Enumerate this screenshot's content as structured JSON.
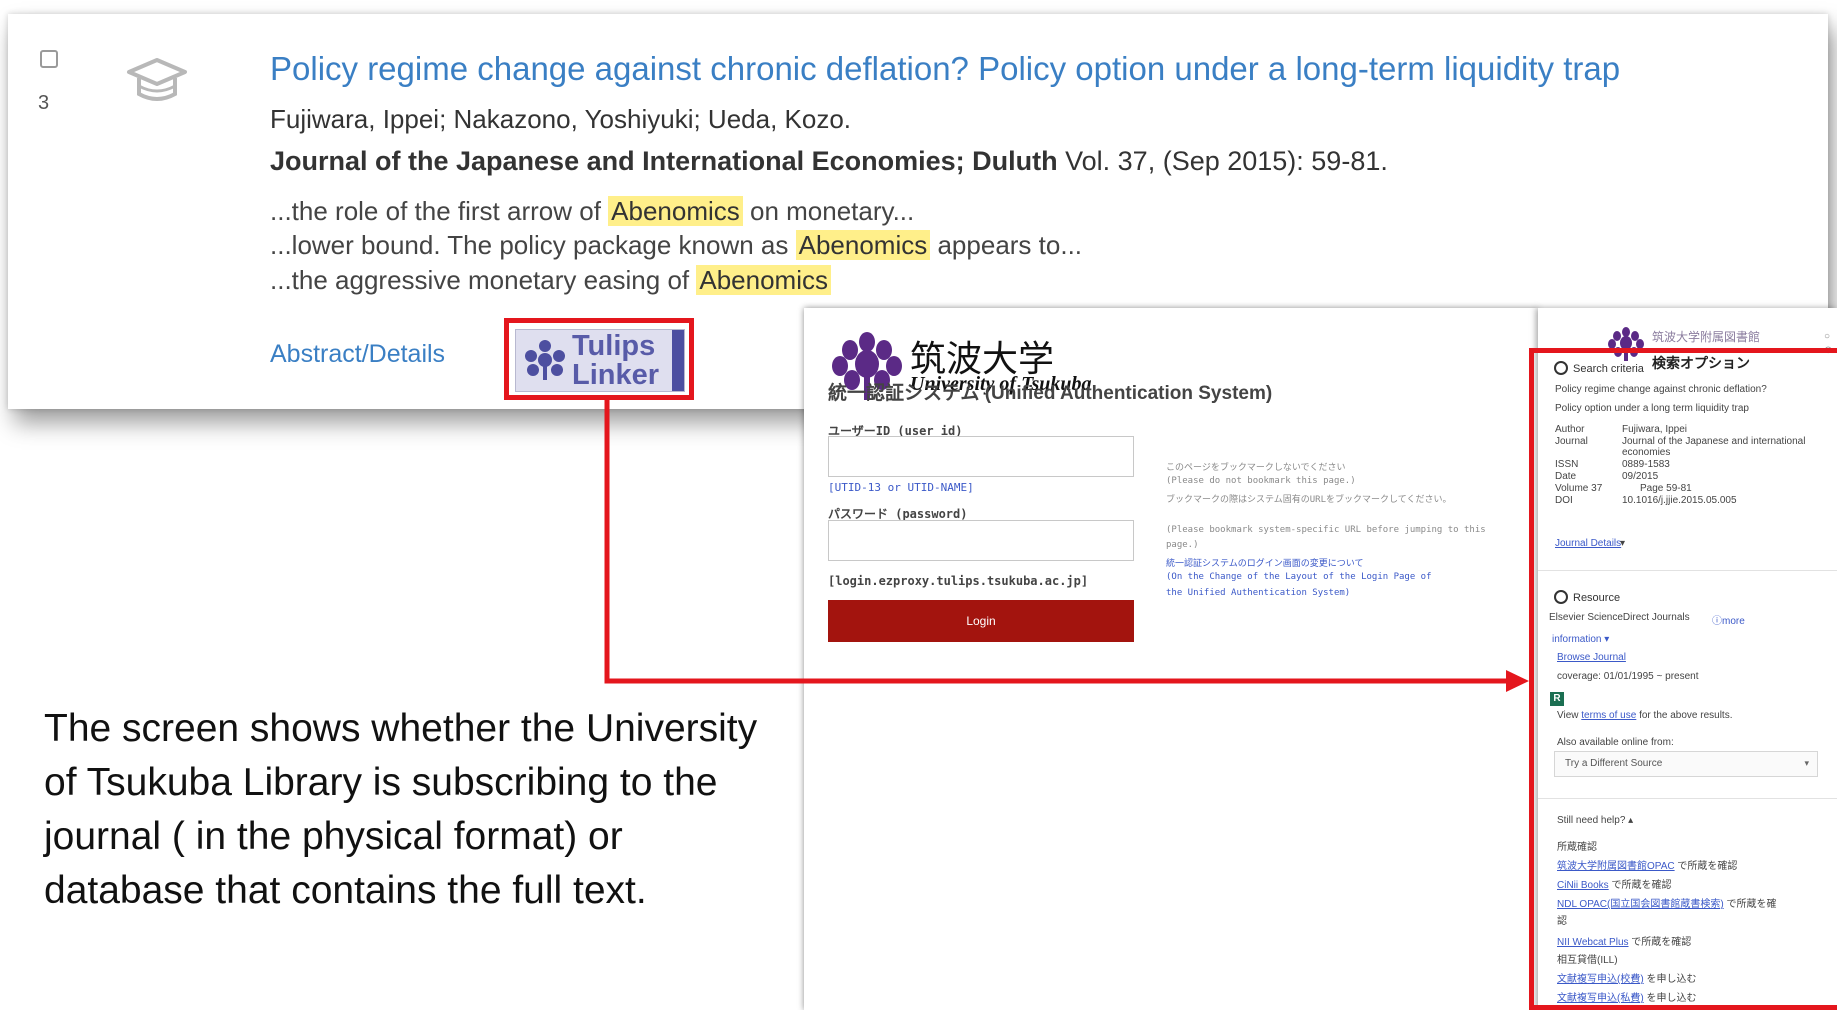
{
  "result": {
    "number": "3",
    "title": "Policy regime change against chronic deflation? Policy option under a long-term liquidity trap",
    "authors": "Fujiwara, Ippei; Nakazono, Yoshiyuki; Ueda, Kozo.",
    "journal": "Journal of the Japanese and International Economies; Duluth",
    "citation": " Vol. 37,  (Sep 2015): 59-81.",
    "snippets": [
      {
        "pre": "...the role of the first arrow of ",
        "hl": "Abenomics",
        "post": " on monetary..."
      },
      {
        "pre": "...lower bound. The policy package known as ",
        "hl": "Abenomics",
        "post": " appears to..."
      },
      {
        "pre": "...the aggressive monetary easing of ",
        "hl": "Abenomics",
        "post": ""
      }
    ],
    "abstract_link": "Abstract/Details",
    "linker_label_1": "Tulips",
    "linker_label_2": "Linker"
  },
  "login": {
    "brand_jp": "筑波大学",
    "brand_en": "University of Tsukuba",
    "title": "統一認証システム (Unified Authentication System)",
    "user_label": "ユーザーID (user id)",
    "utid": "[UTID-13 or UTID-NAME]",
    "password_label": "パスワード (password)",
    "domain": "[login.ezproxy.tulips.tsukuba.ac.jp]",
    "button": "Login",
    "notes": [
      "このページをブックマークしないでください",
      "(Please do not bookmark this page.)",
      "ブックマークの際はシステム固有のURLをブックマークしてください。",
      "(Please bookmark system-specific URL before jumping to this",
      "page.)",
      "統一認証システムのログイン画面の変更について",
      "(On the Change of the Layout of the Login Page of",
      "the Unified Authentication System)"
    ]
  },
  "library": {
    "title": "筑波大学附属図書館",
    "subtitle": "検索オプション",
    "criteria_head": "Search criteria",
    "criteria_title_1": "Policy regime change against chronic deflation?",
    "criteria_title_2": "Policy option under a long term liquidity trap",
    "fields": [
      {
        "k": "Author",
        "v": "Fujiwara, Ippei"
      },
      {
        "k": "Journal",
        "v": "Journal of the Japanese and international"
      },
      {
        "k": "",
        "v": "economies"
      },
      {
        "k": "ISSN",
        "v": "0889-1583"
      },
      {
        "k": "Date",
        "v": "09/2015"
      },
      {
        "k": "Volume 37",
        "v": "Page 59-81"
      },
      {
        "k": "DOI",
        "v": "10.1016/j.jjie.2015.05.005"
      }
    ],
    "journal_details": "Journal Details",
    "resource_head": "Resource",
    "resource_name": "Elsevier ScienceDirect Journals",
    "more_info": "ⓘmore",
    "information": "information",
    "browse": "Browse Journal",
    "coverage": "coverage: 01/01/1995 ~ present",
    "badge": "R",
    "view_pre": "View ",
    "terms": "terms of use",
    "view_post": " for the above results.",
    "also": "Also available online from:",
    "try": "Try a Different Source",
    "help_head": "Still need help?",
    "holdings_head": "所蔵確認",
    "help_links": [
      {
        "link": "筑波大学附属図書館OPAC",
        "text": " で所蔵を確認"
      },
      {
        "link": "CiNii Books",
        "text": " で所蔵を確認"
      },
      {
        "link": "NDL OPAC(国立国会図書館蔵書検索)",
        "text": " で所蔵を確"
      },
      {
        "link": "",
        "text": "認"
      },
      {
        "link": "NII Webcat Plus",
        "text": " で所蔵を確認"
      },
      {
        "link": "",
        "text": "相互貸借(ILL)"
      },
      {
        "link": "文献複写申込(校費)",
        "text": " を申し込む"
      },
      {
        "link": "文献複写申込(私費)",
        "text": " を申し込む"
      }
    ]
  },
  "caption": "The screen shows whether the University of Tsukuba Library is subscribing to the journal ( in the physical format) or database that contains the full text.",
  "colors": {
    "highlight": "#ffef8a",
    "link": "#3a7fc4",
    "callout_red": "#e4161d",
    "login_button": "#a3140e"
  }
}
